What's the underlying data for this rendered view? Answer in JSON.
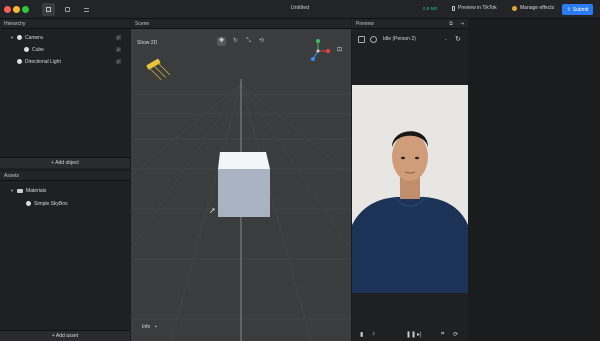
{
  "app": {
    "title": "Untitled",
    "version": "0.5 M0"
  },
  "toolbar": {
    "preview_tiktok": "Preview in TikTok",
    "manage_effects": "Manage effects",
    "submit": "Submit"
  },
  "hierarchy": {
    "title": "Hierarchy",
    "items": [
      {
        "label": "Camera"
      },
      {
        "label": "Cube"
      },
      {
        "label": "Directional Light"
      }
    ],
    "add_label": "+ Add object"
  },
  "assets": {
    "title": "Assets",
    "items": [
      {
        "label": "Materials"
      },
      {
        "label": "Simple SkyBox"
      }
    ],
    "add_label": "+ Add asset"
  },
  "scene": {
    "title": "Scene",
    "show2d": "Show 2D",
    "info": "Info"
  },
  "preview": {
    "title": "Preview",
    "mode": "Idle (Person 2)"
  },
  "colors": {
    "accent": "#2b7bf2",
    "version": "#1ec27c",
    "gizmo_x": "#e8453c",
    "gizmo_y": "#38c262",
    "gizmo_z": "#3b8ff0"
  }
}
